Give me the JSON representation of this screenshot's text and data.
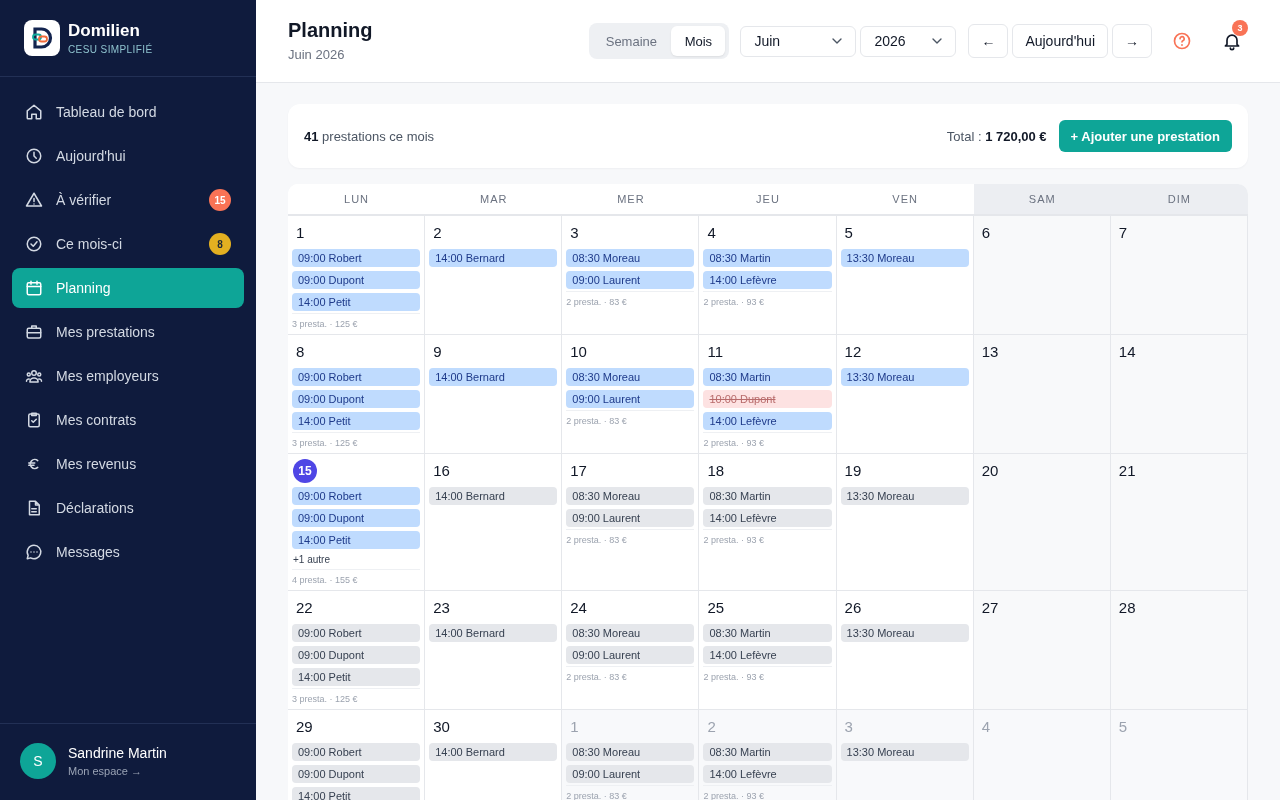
{
  "sidebar": {
    "brand": {
      "name": "Domilien",
      "tagline": "CESU SIMPLIFIÉ"
    },
    "items": [
      {
        "label": "Tableau de bord",
        "selected": false
      },
      {
        "label": "Aujourd'hui",
        "selected": false
      },
      {
        "label": "À vérifier",
        "selected": false,
        "badge": {
          "text": "15",
          "color": "#f97356"
        }
      },
      {
        "label": "Ce mois-ci",
        "selected": false,
        "badge": {
          "text": "8",
          "color": "#e3b021"
        }
      },
      {
        "label": "Planning",
        "selected": true
      },
      {
        "label": "Mes prestations",
        "selected": false
      },
      {
        "label": "Mes employeurs",
        "selected": false
      },
      {
        "label": "Mes contrats",
        "selected": false
      },
      {
        "label": "Mes revenus",
        "selected": false
      },
      {
        "label": "Déclarations",
        "selected": false
      },
      {
        "label": "Messages",
        "selected": false
      }
    ],
    "user": {
      "initial": "S",
      "name": "Sandrine Martin",
      "link": "Mon espace →"
    }
  },
  "header": {
    "title": "Planning",
    "subtitle": "Juin 2026",
    "view_toggle": [
      {
        "label": "Semaine",
        "selected": false
      },
      {
        "label": "Mois",
        "selected": true
      }
    ],
    "month_select": {
      "value": "Juin"
    },
    "year_select": {
      "value": "2026"
    },
    "prev_button": "←",
    "today_button": "Aujourd'hui",
    "next_button": "→",
    "notifications": {
      "count": "3"
    }
  },
  "summary": {
    "count": "**41** prestations ce mois",
    "total": "Total : **1 720,00 €**",
    "add_button": "+ Ajouter une prestation"
  },
  "calendar": {
    "columns": [
      {
        "label": "LUN",
        "weekend": false
      },
      {
        "label": "MAR",
        "weekend": false
      },
      {
        "label": "MER",
        "weekend": false
      },
      {
        "label": "JEU",
        "weekend": false
      },
      {
        "label": "VEN",
        "weekend": false
      },
      {
        "label": "SAM",
        "weekend": true
      },
      {
        "label": "DIM",
        "weekend": true
      }
    ],
    "weeks": [
      {
        "days": [
          {
            "day": "1",
            "today": false,
            "outside": false,
            "events": [
              {
                "label": "09:00 Robert",
                "kind": "done"
              },
              {
                "label": "09:00 Dupont",
                "kind": "done"
              },
              {
                "label": "14:00 Petit",
                "kind": "done"
              }
            ],
            "summary": "3 presta. · 125 €"
          },
          {
            "day": "2",
            "today": false,
            "outside": false,
            "events": [
              {
                "label": "14:00 Bernard",
                "kind": "done"
              }
            ]
          },
          {
            "day": "3",
            "today": false,
            "outside": false,
            "events": [
              {
                "label": "08:30 Moreau",
                "kind": "done"
              },
              {
                "label": "09:00 Laurent",
                "kind": "done"
              }
            ],
            "summary": "2 presta. · 83 €"
          },
          {
            "day": "4",
            "today": false,
            "outside": false,
            "events": [
              {
                "label": "08:30 Martin",
                "kind": "done"
              },
              {
                "label": "14:00 Lefèvre",
                "kind": "done"
              }
            ],
            "summary": "2 presta. · 93 €"
          },
          {
            "day": "5",
            "today": false,
            "outside": false,
            "events": [
              {
                "label": "13:30 Moreau",
                "kind": "done"
              }
            ]
          },
          {
            "day": "6",
            "today": false,
            "outside": false
          },
          {
            "day": "7",
            "today": false,
            "outside": false
          }
        ]
      },
      {
        "days": [
          {
            "day": "8",
            "today": false,
            "outside": false,
            "events": [
              {
                "label": "09:00 Robert",
                "kind": "done"
              },
              {
                "label": "09:00 Dupont",
                "kind": "done"
              },
              {
                "label": "14:00 Petit",
                "kind": "done"
              }
            ],
            "summary": "3 presta. · 125 €"
          },
          {
            "day": "9",
            "today": false,
            "outside": false,
            "events": [
              {
                "label": "14:00 Bernard",
                "kind": "done"
              }
            ]
          },
          {
            "day": "10",
            "today": false,
            "outside": false,
            "events": [
              {
                "label": "08:30 Moreau",
                "kind": "done"
              },
              {
                "label": "09:00 Laurent",
                "kind": "done"
              }
            ],
            "summary": "2 presta. · 83 €"
          },
          {
            "day": "11",
            "today": false,
            "outside": false,
            "events": [
              {
                "label": "08:30 Martin",
                "kind": "done"
              },
              {
                "label": "10:00 Dupont",
                "kind": "cancelled"
              },
              {
                "label": "14:00 Lefèvre",
                "kind": "done"
              }
            ],
            "summary": "2 presta. · 93 €"
          },
          {
            "day": "12",
            "today": false,
            "outside": false,
            "events": [
              {
                "label": "13:30 Moreau",
                "kind": "done"
              }
            ]
          },
          {
            "day": "13",
            "today": false,
            "outside": false
          },
          {
            "day": "14",
            "today": false,
            "outside": false
          }
        ]
      },
      {
        "days": [
          {
            "day": "15",
            "today": true,
            "outside": false,
            "events": [
              {
                "label": "09:00 Robert",
                "kind": "done"
              },
              {
                "label": "09:00 Dupont",
                "kind": "done"
              },
              {
                "label": "14:00 Petit",
                "kind": "done"
              }
            ],
            "more": "+1 autre",
            "summary": "4 presta. · 155 €"
          },
          {
            "day": "16",
            "today": false,
            "outside": false,
            "events": [
              {
                "label": "14:00 Bernard",
                "kind": "planned"
              }
            ]
          },
          {
            "day": "17",
            "today": false,
            "outside": false,
            "events": [
              {
                "label": "08:30 Moreau",
                "kind": "planned"
              },
              {
                "label": "09:00 Laurent",
                "kind": "planned"
              }
            ],
            "summary": "2 presta. · 83 €"
          },
          {
            "day": "18",
            "today": false,
            "outside": false,
            "events": [
              {
                "label": "08:30 Martin",
                "kind": "planned"
              },
              {
                "label": "14:00 Lefèvre",
                "kind": "planned"
              }
            ],
            "summary": "2 presta. · 93 €"
          },
          {
            "day": "19",
            "today": false,
            "outside": false,
            "events": [
              {
                "label": "13:30 Moreau",
                "kind": "planned"
              }
            ]
          },
          {
            "day": "20",
            "today": false,
            "outside": false
          },
          {
            "day": "21",
            "today": false,
            "outside": false
          }
        ]
      },
      {
        "days": [
          {
            "day": "22",
            "today": false,
            "outside": false,
            "events": [
              {
                "label": "09:00 Robert",
                "kind": "planned"
              },
              {
                "label": "09:00 Dupont",
                "kind": "planned"
              },
              {
                "label": "14:00 Petit",
                "kind": "planned"
              }
            ],
            "summary": "3 presta. · 125 €"
          },
          {
            "day": "23",
            "today": false,
            "outside": false,
            "events": [
              {
                "label": "14:00 Bernard",
                "kind": "planned"
              }
            ]
          },
          {
            "day": "24",
            "today": false,
            "outside": false,
            "events": [
              {
                "label": "08:30 Moreau",
                "kind": "planned"
              },
              {
                "label": "09:00 Laurent",
                "kind": "planned"
              }
            ],
            "summary": "2 presta. · 83 €"
          },
          {
            "day": "25",
            "today": false,
            "outside": false,
            "events": [
              {
                "label": "08:30 Martin",
                "kind": "planned"
              },
              {
                "label": "14:00 Lefèvre",
                "kind": "planned"
              }
            ],
            "summary": "2 presta. · 93 €"
          },
          {
            "day": "26",
            "today": false,
            "outside": false,
            "events": [
              {
                "label": "13:30 Moreau",
                "kind": "planned"
              }
            ]
          },
          {
            "day": "27",
            "today": false,
            "outside": false
          },
          {
            "day": "28",
            "today": false,
            "outside": false
          }
        ]
      },
      {
        "days": [
          {
            "day": "29",
            "today": false,
            "outside": false,
            "events": [
              {
                "label": "09:00 Robert",
                "kind": "planned"
              },
              {
                "label": "09:00 Dupont",
                "kind": "planned"
              },
              {
                "label": "14:00 Petit",
                "kind": "planned"
              }
            ]
          },
          {
            "day": "30",
            "today": false,
            "outside": false,
            "events": [
              {
                "label": "14:00 Bernard",
                "kind": "planned"
              }
            ]
          },
          {
            "day": "1",
            "today": false,
            "outside": true,
            "events": [
              {
                "label": "08:30 Moreau",
                "kind": "planned"
              },
              {
                "label": "09:00 Laurent",
                "kind": "planned"
              }
            ],
            "summary": "2 presta. · 83 €"
          },
          {
            "day": "2",
            "today": false,
            "outside": true,
            "events": [
              {
                "label": "08:30 Martin",
                "kind": "planned"
              },
              {
                "label": "14:00 Lefèvre",
                "kind": "planned"
              }
            ],
            "summary": "2 presta. · 93 €"
          },
          {
            "day": "3",
            "today": false,
            "outside": true,
            "events": [
              {
                "label": "13:30 Moreau",
                "kind": "planned"
              }
            ]
          },
          {
            "day": "4",
            "today": false,
            "outside": true
          },
          {
            "day": "5",
            "today": false,
            "outside": true
          }
        ]
      }
    ]
  }
}
